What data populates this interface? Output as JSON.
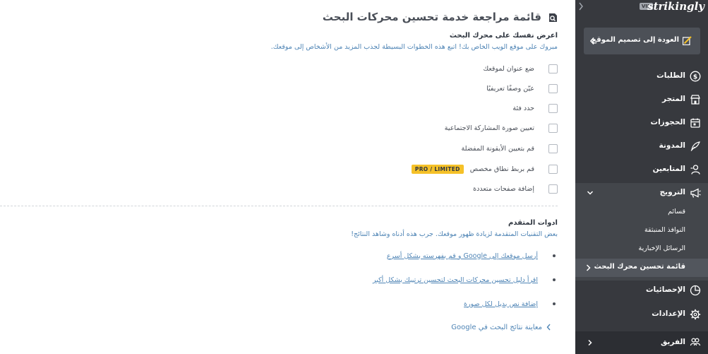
{
  "main": {
    "title": "قائمة مراجعة خدمة تحسين محركات البحث",
    "section1": {
      "title": "اعرض نفسك على محرك البحث",
      "subtitle": "مبروك على موقع الويب الخاص بك! اتبع هذه الخطوات البسيطة لجذب المزيد من الأشخاص إلى موقعك.",
      "items": [
        {
          "label": "ضع عنوان لموقعك"
        },
        {
          "label": "عيّن وصفًا تعريفيًا"
        },
        {
          "label": "حدد فئة"
        },
        {
          "label": "تعيين صورة المشاركة الاجتماعية"
        },
        {
          "label": "قم بتعيين الأيقونة المفضلة"
        },
        {
          "label": "قم بربط نطاق مخصص",
          "badge": "PRO / LIMITED"
        },
        {
          "label": "إضافة صفحات متعددة"
        }
      ]
    },
    "section2": {
      "title": "ادوات المتقدم",
      "subtitle": "بعض التقنيات المتقدمة لزيادة ظهور موقعك. جرب هذه أدناه وشاهد النتائج!",
      "links": [
        {
          "label": "أرسل موقعك إلى Google و قم بفهرسته بشكل أسرع"
        },
        {
          "label": "اقرأ دليل تحسين محركات البحث لتحسين ترتيبك بشكل أكبر"
        },
        {
          "label": "إضافة نص بديل لكل صورة"
        }
      ]
    },
    "preview_link": "معاينة نتائج البحث في Google"
  },
  "sidebar": {
    "brand": "strikingly",
    "vip": "VIP",
    "back_label": "العودة إلى تصميم الموقع",
    "nav": {
      "orders": "الطلبات",
      "store": "المتجر",
      "bookings": "الحجوزات",
      "blog": "المدونة",
      "followers": "المتابعين",
      "promote": "الترويج",
      "stats": "الإحصائيات",
      "settings": "الإعدادات",
      "team": "الفريق"
    },
    "promote_sub": {
      "lists": "قسائم",
      "popups": "النوافذ المنبثقة",
      "newsletters": "الرسائل الإخبارية",
      "seo_checklist": "قائمة تحسين محرك البحث"
    }
  },
  "colors": {
    "sidebar_bg": "#37393e",
    "link_blue": "#4e84b5",
    "badge_yellow": "#f5c128"
  }
}
